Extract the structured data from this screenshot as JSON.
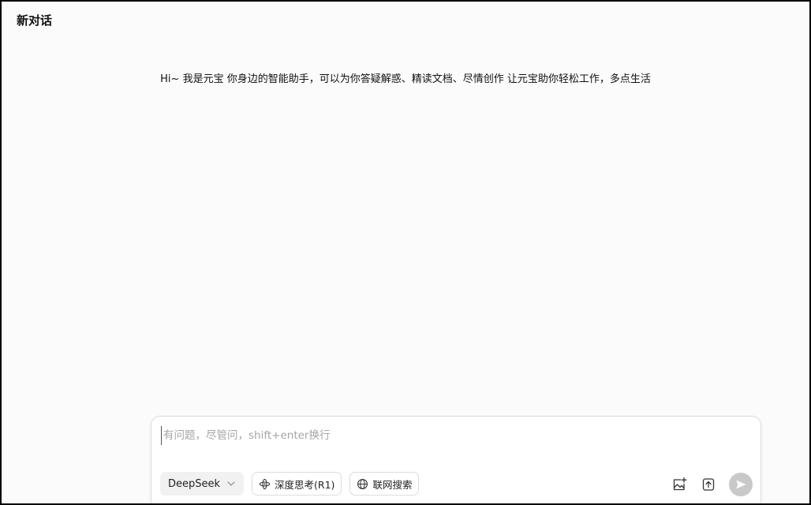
{
  "header": {
    "title": "新对话"
  },
  "welcome": {
    "message": "Hi~ 我是元宝 你身边的智能助手，可以为你答疑解惑、精读文档、尽情创作 让元宝助你轻松工作，多点生活"
  },
  "composer": {
    "placeholder": "有问题，尽管问，shift+enter换行",
    "value": "",
    "model": {
      "selected": "DeepSeek"
    },
    "deep_think_label": "深度思考(R1)",
    "web_search_label": "联网搜索"
  },
  "icons": {
    "model_dropdown": "chevron-down-icon",
    "deep_think": "atom-icon",
    "web_search": "globe-icon",
    "image_upload": "image-add-icon",
    "file_upload": "upload-icon",
    "send": "send-icon"
  },
  "colors": {
    "send_button_disabled": "#c9c9c9",
    "page_background": "#fbfbfb"
  }
}
